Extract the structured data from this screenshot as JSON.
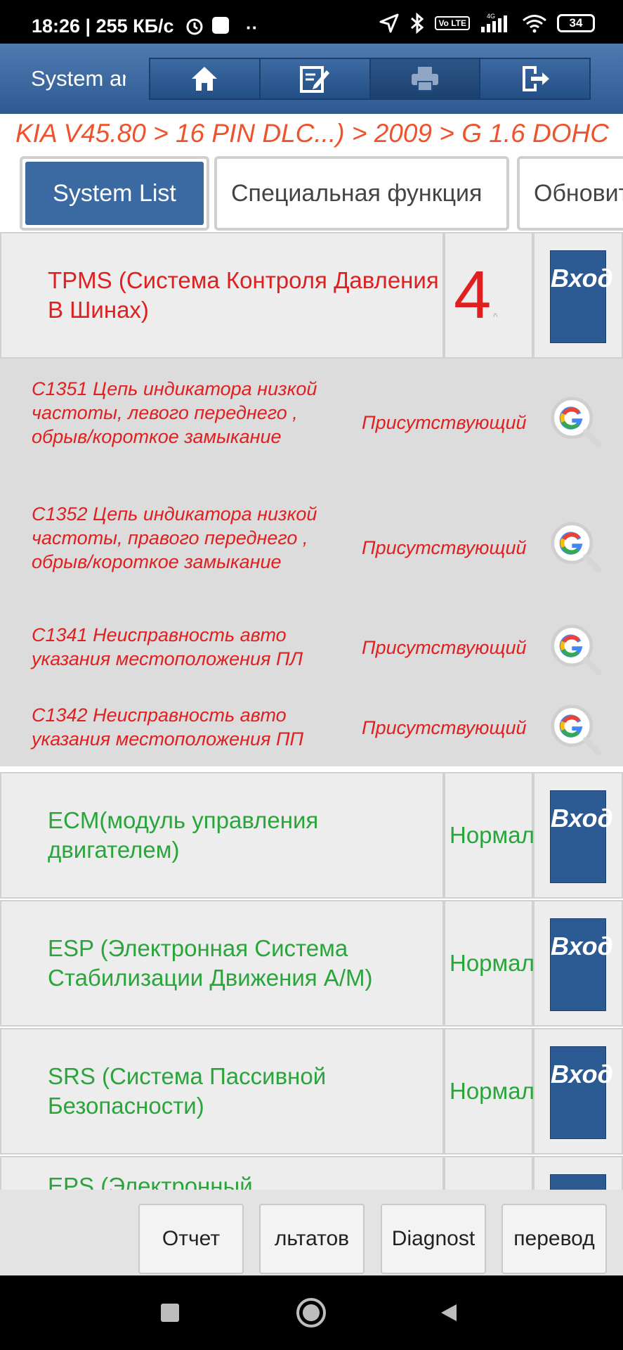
{
  "status_bar": {
    "time": "18:26 | 255 КБ/с",
    "volte": "Vo LTE",
    "network": "4G",
    "battery": "34"
  },
  "header": {
    "title": "System and",
    "toolbar": [
      "home-icon",
      "edit-note-icon",
      "print-icon",
      "exit-icon"
    ]
  },
  "breadcrumb": "KIA V45.80 > 16 PIN DLC...) > 2009 > G 1.6 DOHC",
  "tabs": [
    {
      "label": "System List",
      "active": true
    },
    {
      "label": "Специальная функция",
      "active": false
    },
    {
      "label": "Обновит",
      "active": false
    }
  ],
  "systems": [
    {
      "name": "TPMS (Система Контроля Давления В Шинах)",
      "status": "4",
      "enter": "Вход"
    },
    {
      "name": "ECM(модуль управления двигателем)",
      "status": "Нормально",
      "enter": "Вход"
    },
    {
      "name": "ESP (Электронная Система Стабилизации Движения А/М)",
      "status": "Нормально",
      "enter": "Вход"
    },
    {
      "name": "SRS (Система Пассивной Безопасности)",
      "status": "Нормально",
      "enter": "Вход"
    },
    {
      "name": "EPS (Электронный",
      "status": "",
      "enter": ""
    }
  ],
  "dtcs": [
    {
      "text": "C1351 Цепь индикатора низкой частоты, левого переднего , обрыв/короткое замыкание",
      "status": "Присутствующий"
    },
    {
      "text": "C1352 Цепь индикатора низкой частоты, правого переднего , обрыв/короткое замыкание",
      "status": "Присутствующий"
    },
    {
      "text": "C1341 Неисправность авто указания местоположения ПЛ",
      "status": "Присутствующий"
    },
    {
      "text": "C1342 Неисправность авто указания местоположения ПП",
      "status": "Присутствующий"
    }
  ],
  "bottom_buttons": [
    "Отчет",
    "льтатов",
    "Diagnost",
    "перевод"
  ],
  "colors": {
    "header_blue": "#2d5a93",
    "fault_red": "#e02020",
    "normal_green": "#2aa53b",
    "breadcrumb_orange": "#f0522b"
  }
}
